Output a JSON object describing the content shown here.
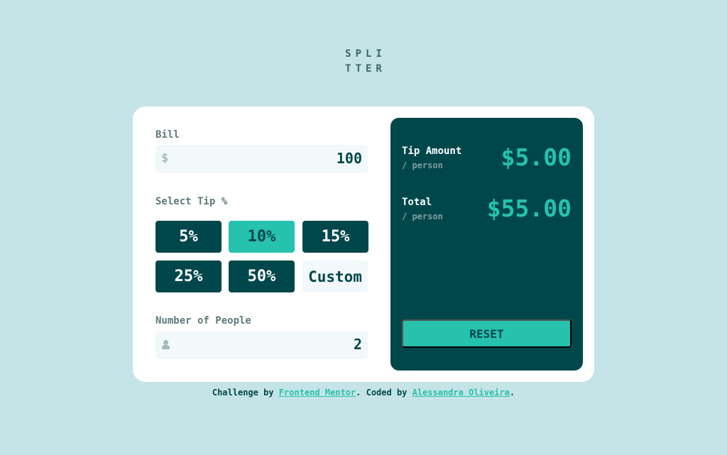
{
  "logo": {
    "line1": "SPLI",
    "line2": "TTER"
  },
  "bill": {
    "label": "Bill",
    "currency_symbol": "$",
    "value": "100"
  },
  "tip": {
    "label": "Select Tip %",
    "options": [
      "5%",
      "10%",
      "15%",
      "25%",
      "50%"
    ],
    "selected": "10%",
    "custom_label": "Custom"
  },
  "people": {
    "label": "Number of People",
    "value": "2"
  },
  "results": {
    "tip_amount": {
      "title": "Tip Amount",
      "sub": "/ person",
      "value": "$5.00"
    },
    "total": {
      "title": "Total",
      "sub": "/ person",
      "value": "$55.00"
    },
    "reset_label": "RESET"
  },
  "attribution": {
    "prefix": "Challenge by ",
    "link1": "Frontend Mentor",
    "middle": ". Coded by ",
    "link2": "Alessandra Oliveira",
    "suffix": "."
  },
  "colors": {
    "background": "#c5e4e7",
    "dark_cyan": "#00474b",
    "accent": "#26c2ad",
    "input_bg": "#f3f9fa"
  },
  "icons": {
    "bill": "dollar-icon",
    "people": "person-icon"
  }
}
